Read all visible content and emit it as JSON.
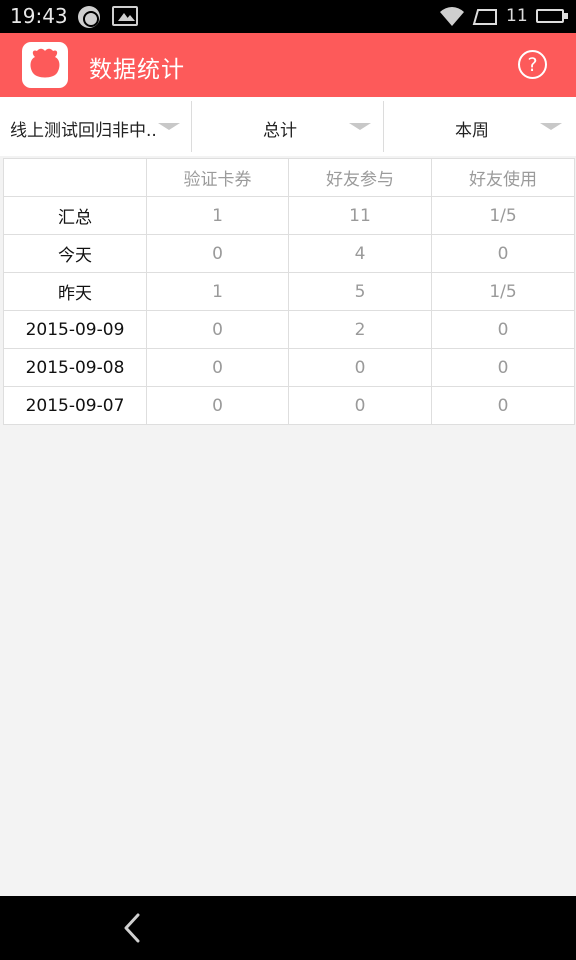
{
  "status_bar": {
    "time": "19:43",
    "signal_count": "11"
  },
  "app_bar": {
    "title": "数据统计",
    "help_label": "?",
    "accent_color": "#fd5a5a"
  },
  "filters": [
    {
      "label": "线上测试回归非中.."
    },
    {
      "label": "总计"
    },
    {
      "label": "本周"
    }
  ],
  "table": {
    "headers": [
      "",
      "验证卡券",
      "好友参与",
      "好友使用"
    ],
    "rows": [
      {
        "label": "汇总",
        "cells": [
          "1",
          "11",
          "1/5"
        ]
      },
      {
        "label": "今天",
        "cells": [
          "0",
          "4",
          "0"
        ]
      },
      {
        "label": "昨天",
        "cells": [
          "1",
          "5",
          "1/5"
        ]
      },
      {
        "label": "2015-09-09",
        "cells": [
          "0",
          "2",
          "0"
        ]
      },
      {
        "label": "2015-09-08",
        "cells": [
          "0",
          "0",
          "0"
        ]
      },
      {
        "label": "2015-09-07",
        "cells": [
          "0",
          "0",
          "0"
        ]
      }
    ]
  },
  "icons": {
    "app_logo": "app-logo-icon",
    "help": "question-circle-icon",
    "back": "back-arrow-icon"
  }
}
